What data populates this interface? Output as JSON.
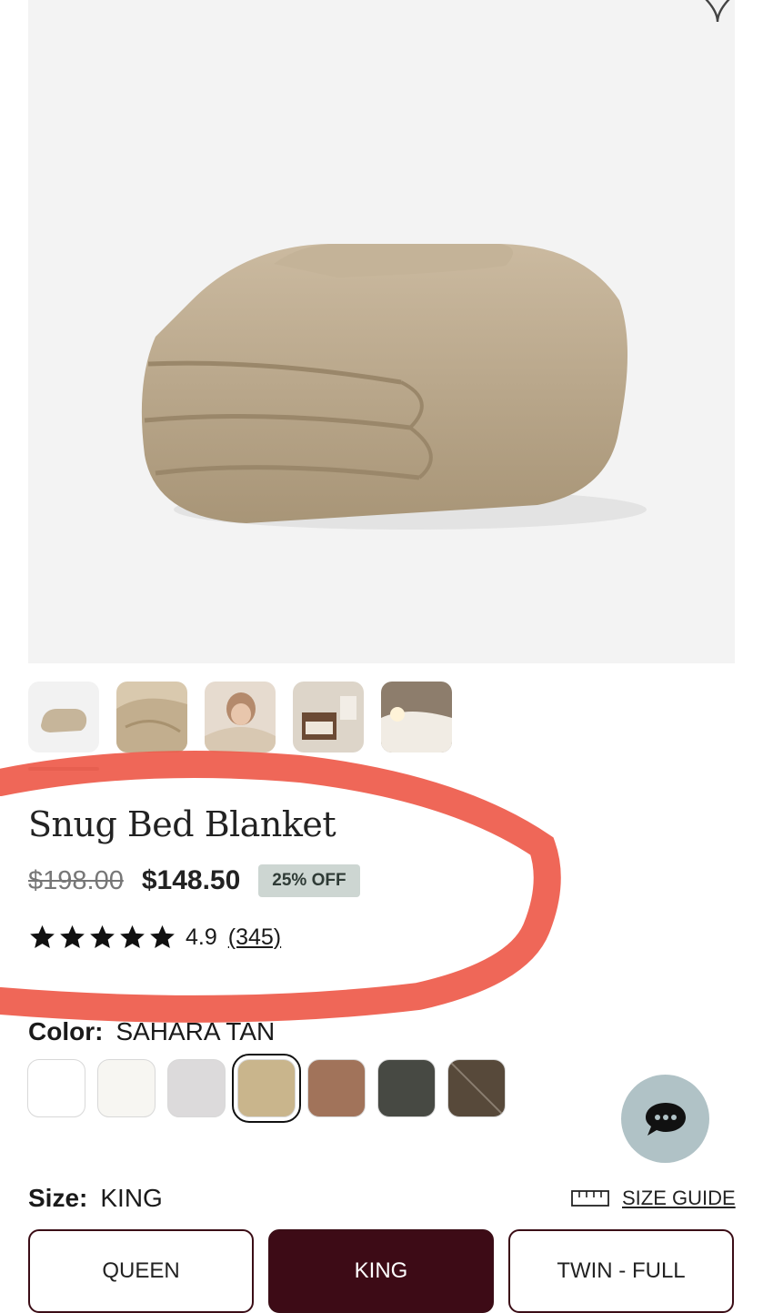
{
  "product": {
    "title": "Snug Bed Blanket",
    "original_price": "$198.00",
    "sale_price": "$148.50",
    "discount_badge": "25% OFF",
    "rating": "4.9",
    "rating_stars": 5,
    "review_count": "(345)"
  },
  "gallery": {
    "selected_index": 0,
    "thumbnail_count": 5
  },
  "color": {
    "label": "Color:",
    "selected": "SAHARA TAN",
    "swatches": [
      "#ffffff",
      "#f7f6f2",
      "#dcdadb",
      "#c9b58c",
      "#a1735a",
      "#474943",
      "#57493a"
    ]
  },
  "size": {
    "label": "Size:",
    "selected": "KING",
    "guide_label": "SIZE GUIDE",
    "options": [
      "QUEEN",
      "KING",
      "TWIN - FULL"
    ]
  },
  "colors": {
    "accent_dark": "#3d0b16",
    "annotation": "#ee5a4a",
    "discount_bg": "#cdd6d2",
    "chat_bg": "#b0c2c6"
  },
  "icons": {
    "wishlist": "heart-icon",
    "chat": "chat-bubble-icon",
    "size_guide": "ruler-icon",
    "rating": "star-icon"
  }
}
